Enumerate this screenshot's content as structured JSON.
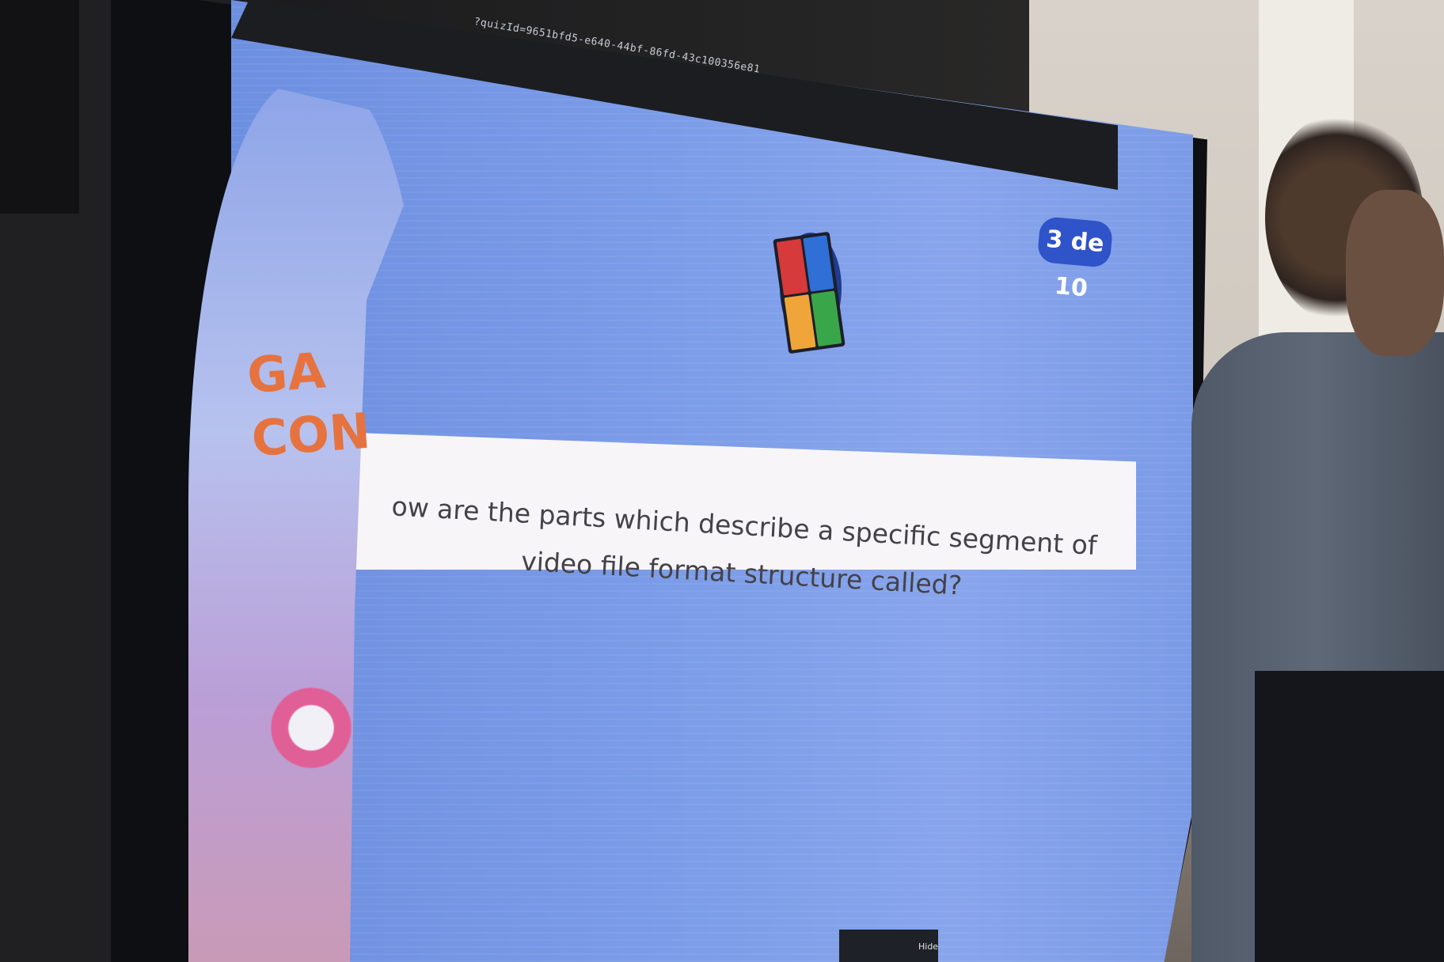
{
  "browser": {
    "url": "?quizId=9651bfd5-e640-44bf-86fd-43c100356e81"
  },
  "quiz": {
    "counter": "3 de 10",
    "question": "ow are the parts which describe a specific segment of video file format structure called?",
    "logo_colors": [
      "#d63a3a",
      "#2f6fd6",
      "#f0a53a",
      "#3aa64a"
    ]
  },
  "screen_share": {
    "hide_label": "Hide"
  },
  "banner": {
    "text": "GA\nCON"
  }
}
